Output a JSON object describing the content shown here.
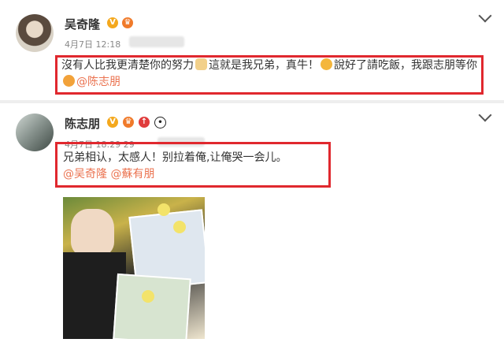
{
  "posts": [
    {
      "user_name": "吴奇隆",
      "badges": [
        "v-badge",
        "crown-badge"
      ],
      "timestamp": "4月7日 12:18",
      "text_main": "沒有人比我更清楚你的努力",
      "text_mid": "這就是我兄弟，真牛！",
      "text_end": "說好了請吃飯，我跟志朋等你",
      "mention": "@陈志朋"
    },
    {
      "user_name": "陈志朋",
      "badges": [
        "v-badge",
        "crown-badge",
        "red-badge",
        "panda-badge"
      ],
      "timestamp": "4月7日 18:29",
      "time_extra": "29",
      "text_main": "兄弟相认，太感人！别拉着俺,让俺哭一会儿。",
      "mention1": "@吴奇隆",
      "mention2": "@蘇有朋"
    }
  ],
  "colors": {
    "highlight": "#e0282e",
    "mention": "#eb7350",
    "verified": "#f4a81d"
  }
}
